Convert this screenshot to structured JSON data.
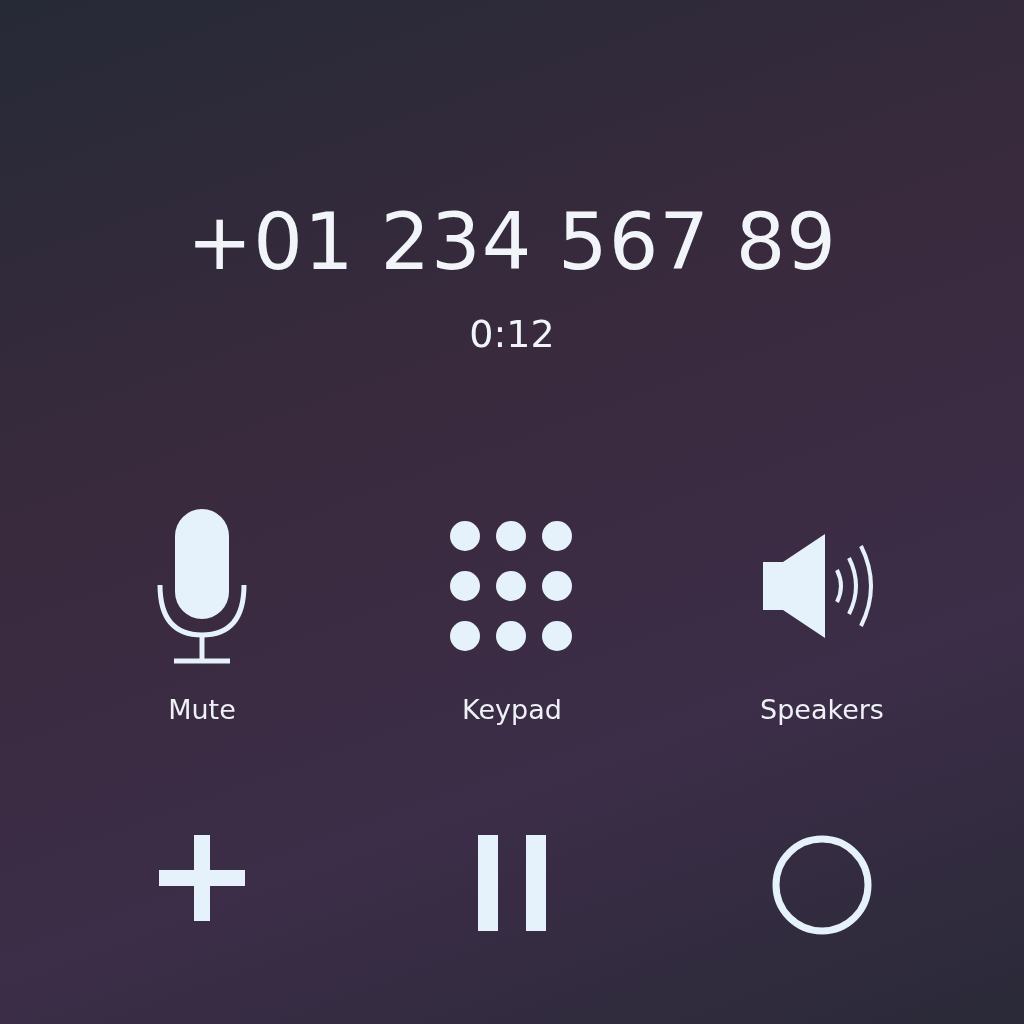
{
  "call": {
    "number": "+01 234 567 89",
    "duration": "0:12"
  },
  "actions": [
    {
      "kind": "mute",
      "label": "Mute"
    },
    {
      "kind": "keypad",
      "label": "Keypad"
    },
    {
      "kind": "speaker",
      "label": "Speakers"
    }
  ],
  "controls": [
    {
      "kind": "add"
    },
    {
      "kind": "hold"
    },
    {
      "kind": "record"
    }
  ]
}
